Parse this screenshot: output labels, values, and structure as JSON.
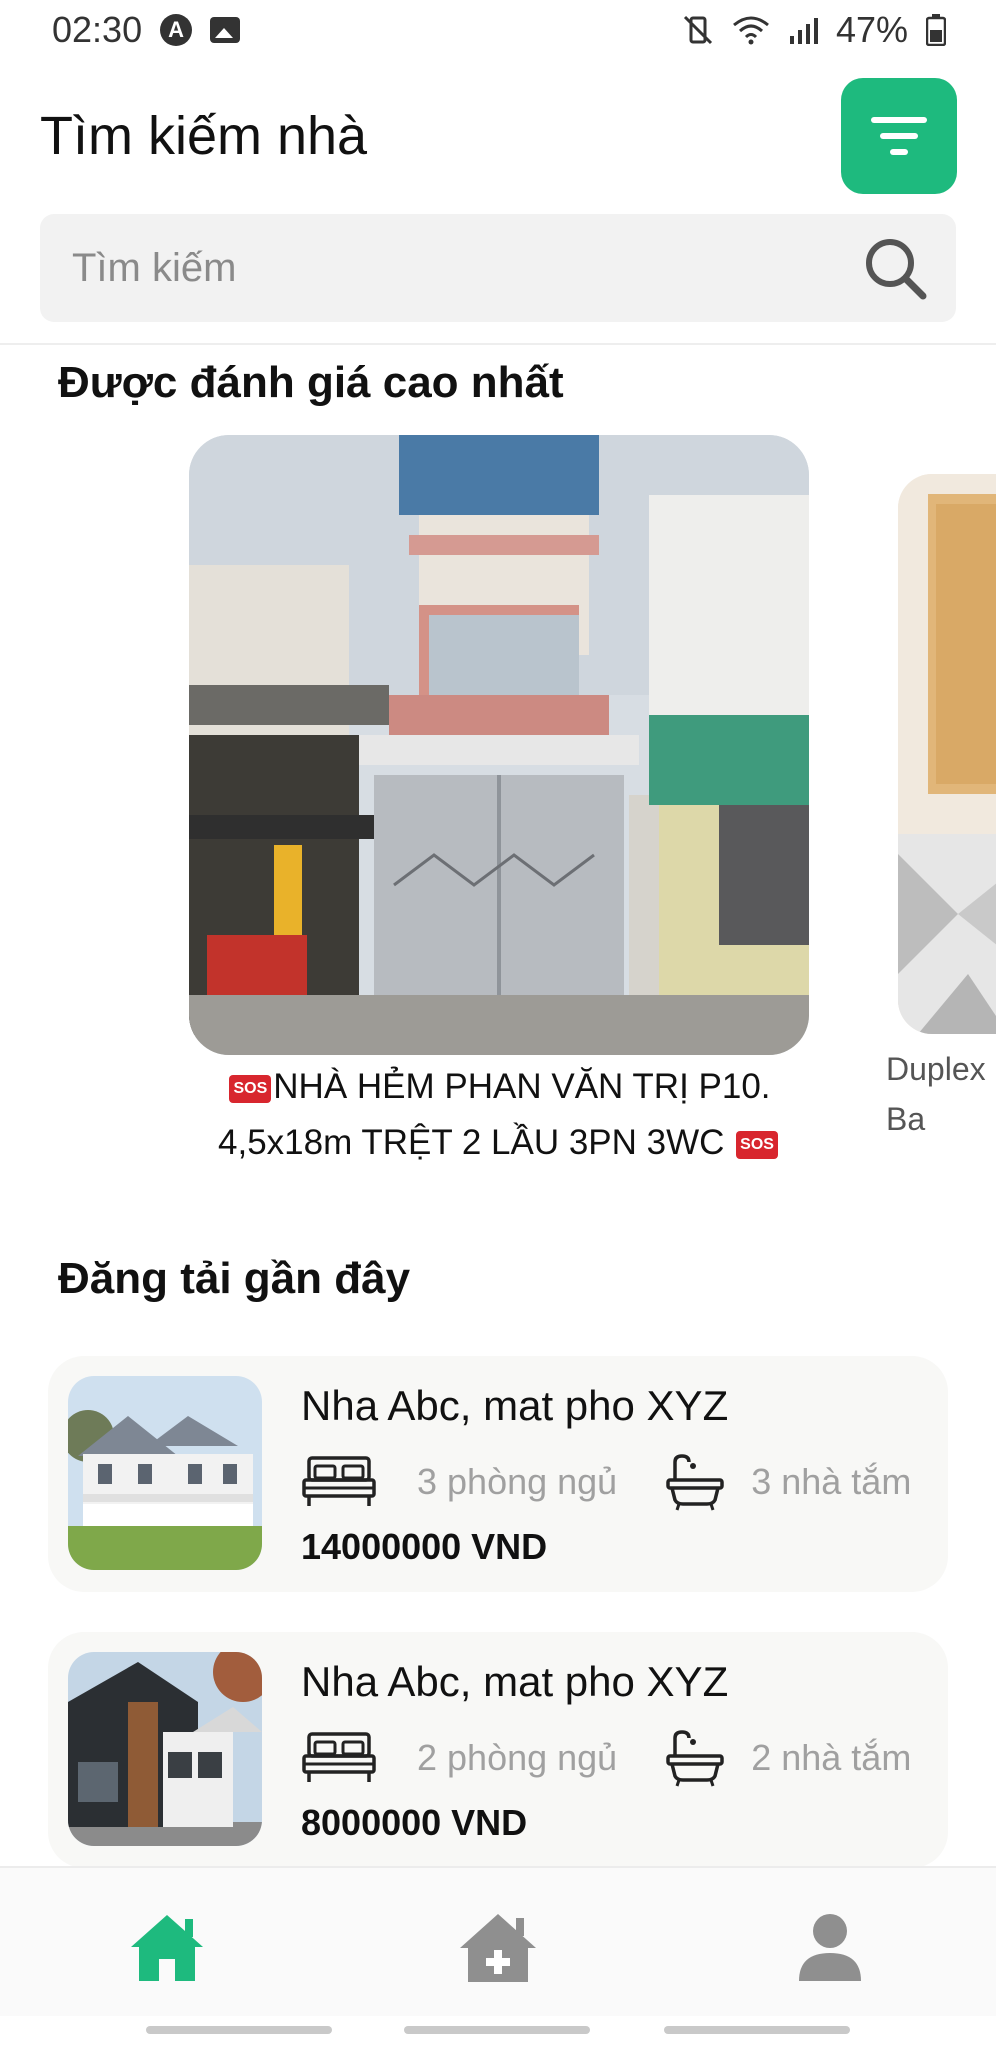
{
  "status_bar": {
    "time": "02:30",
    "badge_a": "A",
    "battery": "47%"
  },
  "header": {
    "title": "Tìm kiếm nhà",
    "filter_icon": "filter-icon",
    "accent_color": "#1eba7e"
  },
  "search": {
    "placeholder": "Tìm kiếm",
    "icon": "search-icon"
  },
  "top_rated": {
    "title": "Được đánh giá cao nhất",
    "items": [
      {
        "line1": "NHÀ HẺM PHAN VĂN TRỊ P10.",
        "line2": "4,5x18m TRỆT 2 LẦU 3PN 3WC",
        "badge": "SOS"
      },
      {
        "line1": "Duplex",
        "line2": "Ba"
      }
    ]
  },
  "recent": {
    "title": "Đăng tải gần đây",
    "items": [
      {
        "title": "Nha Abc, mat pho XYZ",
        "bedrooms": "3 phòng ngủ",
        "bathrooms": "3 nhà tắm",
        "price": "14000000 VND"
      },
      {
        "title": "Nha Abc, mat pho XYZ",
        "bedrooms": "2 phòng ngủ",
        "bathrooms": "2 nhà tắm",
        "price": "8000000 VND"
      }
    ]
  },
  "bottom_nav": {
    "items": [
      {
        "icon": "home-icon",
        "active": true
      },
      {
        "icon": "add-house-icon",
        "active": false
      },
      {
        "icon": "user-icon",
        "active": false
      }
    ]
  }
}
